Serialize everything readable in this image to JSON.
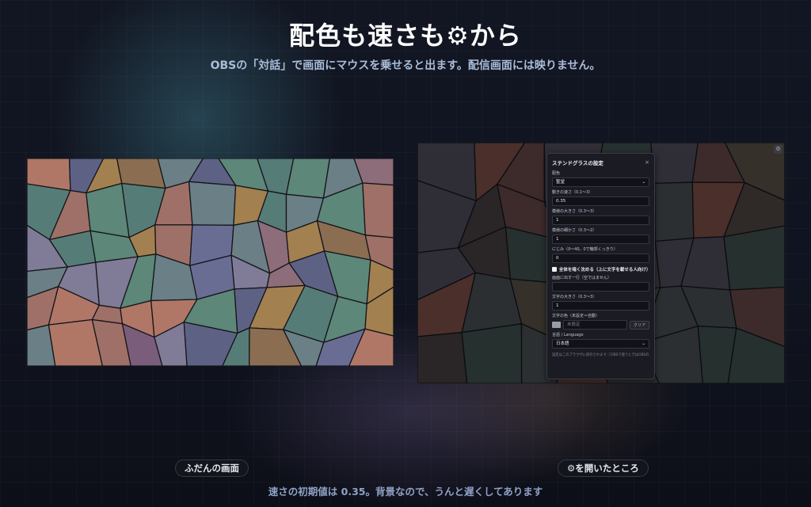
{
  "header": {
    "title": "配色も速さも⚙から",
    "subtitle": "OBSの「対話」で画面にマウスを乗せると出ます。配信画面には映りません。"
  },
  "settings_panel": {
    "title": "ステンドグラスの設定",
    "close_icon": "×",
    "fields": {
      "palette_label": "配色",
      "palette_value": "聖堂",
      "speed_label": "動きの速さ（0.1〜3）",
      "speed_value": "0.35",
      "pattern_size_label": "模様の大きさ（0.3〜3）",
      "pattern_size_value": "1",
      "pattern_detail_label": "模様の細かさ（0.3〜2）",
      "pattern_detail_value": "1",
      "blur_label": "にじみ（0〜40。0で輪郭くっきり）",
      "blur_value": "0",
      "dim_checkbox_label": "全体を暗く沈める（上に文字を載せる人向け）",
      "line_text_label": "画面に出す一行（空ではません）",
      "line_text_value": "",
      "text_size_label": "文字の大きさ（0.3〜3）",
      "text_size_value": "1",
      "text_color_label": "文字の色（未設定＝自動）",
      "text_color_value": "未設定",
      "clear_button": "クリア",
      "language_label": "言語 / Language",
      "language_value": "日本語"
    },
    "footer": "設定はこのブラウザに保存されます ⓘOBSで使うときはOBSの"
  },
  "captions": {
    "normal": "ふだんの画面",
    "opened": "⚙を開いたところ"
  },
  "footnote": "速さの初期値は 0.35。背景なので、うんと遅くしてあります",
  "colors": {
    "left_palette": [
      "#8d6d79",
      "#b07767",
      "#7a5d7b",
      "#5d6285",
      "#6a7f86",
      "#5d8778",
      "#8b6d52",
      "#9f7067",
      "#807b96",
      "#6a6d93",
      "#567c78",
      "#a3804f"
    ],
    "right_palette": [
      "#2a2527",
      "#2f2a28",
      "#3d2a2a",
      "#2b2f31",
      "#26302f",
      "#2f2d35",
      "#35302a",
      "#4a2f2a"
    ]
  }
}
